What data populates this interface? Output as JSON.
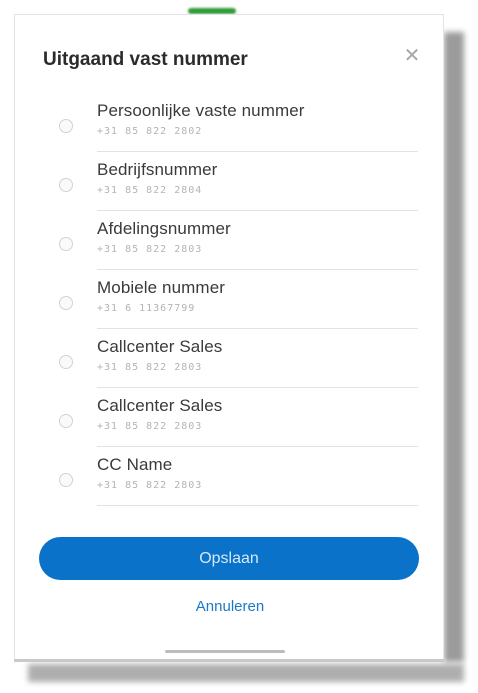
{
  "dialog": {
    "title": "Uitgaand vast nummer",
    "close_icon": "close-icon"
  },
  "options": [
    {
      "label": "Persoonlijke vaste nummer",
      "number": "+31 85 822 2802",
      "selected": false
    },
    {
      "label": "Bedrijfsnummer",
      "number": "+31 85 822 2804",
      "selected": false
    },
    {
      "label": "Afdelingsnummer",
      "number": "+31 85 822 2803",
      "selected": false
    },
    {
      "label": "Mobiele nummer",
      "number": "+31 6 11367799",
      "selected": false
    },
    {
      "label": "Callcenter Sales",
      "number": "+31 85 822 2803",
      "selected": false
    },
    {
      "label": "Callcenter Sales",
      "number": "+31 85 822 2803",
      "selected": false
    },
    {
      "label": "CC Name",
      "number": "+31 85 822 2803",
      "selected": false
    }
  ],
  "actions": {
    "save_label": "Opslaan",
    "cancel_label": "Annuleren"
  },
  "colors": {
    "accent": "#0a72c8",
    "link": "#1b78c9",
    "status_bar_accent": "#2f9c39"
  }
}
